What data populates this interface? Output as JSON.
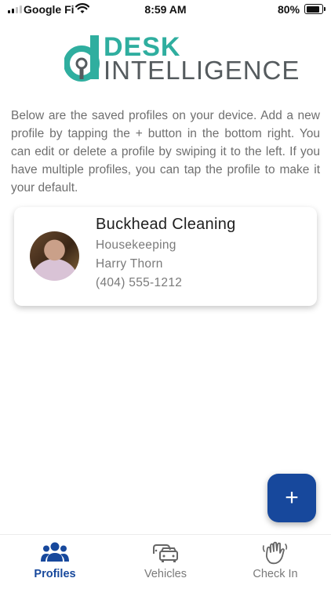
{
  "status_bar": {
    "carrier": "Google Fi",
    "time": "8:59 AM",
    "battery_percent": "80%",
    "battery_level": 0.8
  },
  "logo": {
    "line1": "DESK",
    "line2": "INTELLIGENCE",
    "colors": {
      "teal": "#2fae9f",
      "gray": "#555b5e"
    }
  },
  "intro_text": "Below are the saved profiles on your device. Add a new profile by tapping the + button in the bottom right. You can edit or delete a profile by swiping it to the left. If you have multiple profiles, you can tap the profile to make it your default.",
  "profiles": [
    {
      "name": "Buckhead Cleaning",
      "department": "Housekeeping",
      "contact": "Harry Thorn",
      "phone": "(404) 555-1212"
    }
  ],
  "fab": {
    "label": "+",
    "color": "#17489c"
  },
  "bottom_nav": {
    "items": [
      {
        "label": "Profiles",
        "icon": "people-icon",
        "active": true
      },
      {
        "label": "Vehicles",
        "icon": "cars-icon",
        "active": false
      },
      {
        "label": "Check In",
        "icon": "waving-hand-icon",
        "active": false
      }
    ],
    "active_color": "#17489c"
  }
}
